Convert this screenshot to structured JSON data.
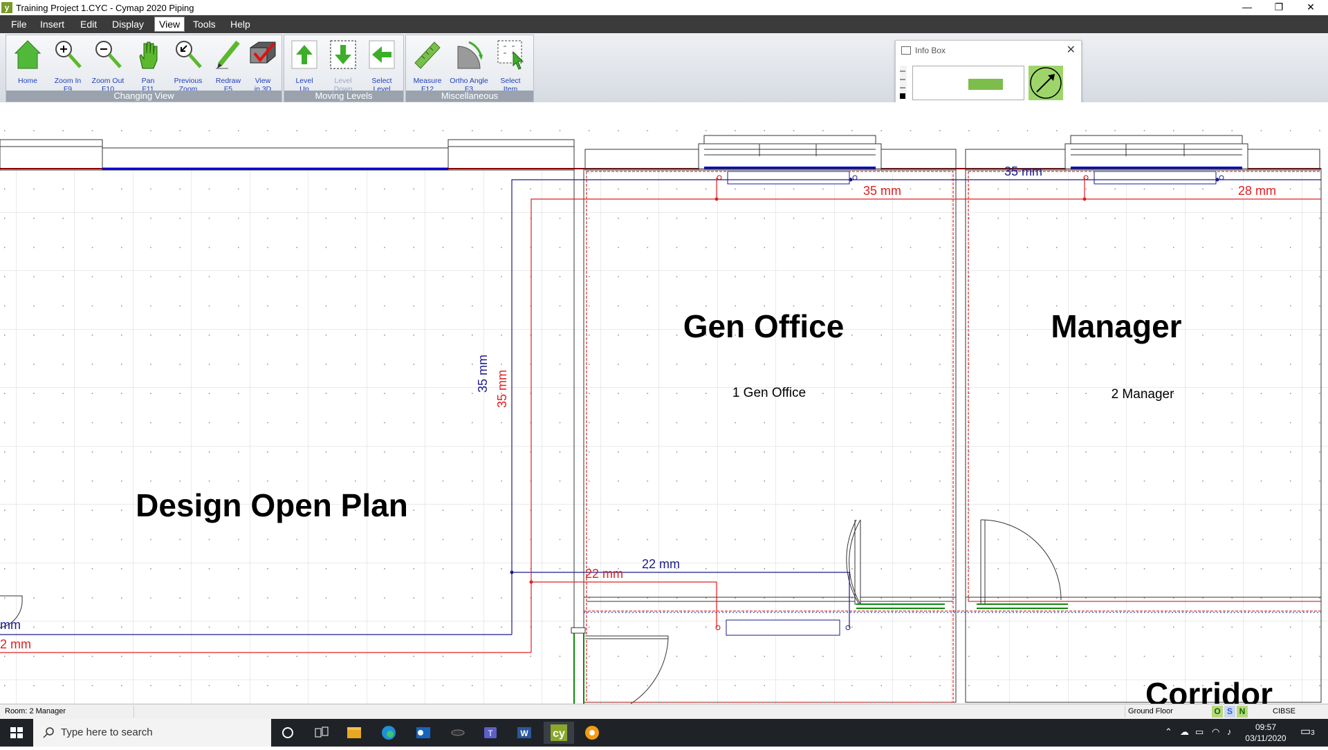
{
  "window": {
    "title": "Training Project 1.CYC - Cymap 2020 Piping",
    "app_icon": "cymap-app-icon",
    "controls": [
      "minimize-icon",
      "restore-icon",
      "close-icon"
    ]
  },
  "menu": {
    "items": [
      "File",
      "Insert",
      "Edit",
      "Display",
      "View",
      "Tools",
      "Help"
    ],
    "active": "View"
  },
  "ribbon": {
    "groups": [
      {
        "label": "Changing View",
        "buttons": [
          {
            "label": "Home",
            "shortcut": "",
            "icon": "home-icon"
          },
          {
            "label": "Zoom In",
            "shortcut": "F9",
            "icon": "zoom-in-icon"
          },
          {
            "label": "Zoom Out",
            "shortcut": "F10",
            "icon": "zoom-out-icon"
          },
          {
            "label": "Pan",
            "shortcut": "F11",
            "icon": "pan-hand-icon"
          },
          {
            "label": "Previous",
            "shortcut": "Zoom",
            "icon": "previous-zoom-icon"
          },
          {
            "label": "Redraw",
            "shortcut": "F5",
            "icon": "redraw-pencil-icon"
          },
          {
            "label": "View",
            "shortcut": "in 3D",
            "icon": "view-3d-icon"
          }
        ]
      },
      {
        "label": "Moving Levels",
        "buttons": [
          {
            "label": "Level",
            "shortcut": "Up",
            "icon": "level-up-icon"
          },
          {
            "label": "Level",
            "shortcut": "Down",
            "icon": "level-down-icon",
            "disabled": true
          },
          {
            "label": "Select",
            "shortcut": "Level",
            "icon": "select-level-icon"
          }
        ]
      },
      {
        "label": "Miscellaneous",
        "buttons": [
          {
            "label": "Measure",
            "shortcut": "F12",
            "icon": "measure-ruler-icon"
          },
          {
            "label": "Ortho Angle",
            "shortcut": "F3",
            "icon": "ortho-angle-icon"
          },
          {
            "label": "Select",
            "shortcut": "Item",
            "icon": "select-item-icon"
          }
        ]
      }
    ]
  },
  "info_box": {
    "title": "Info Box",
    "compass_icon": "north-compass-icon"
  },
  "drawing": {
    "rooms": [
      {
        "name": "Design Open Plan",
        "label": ""
      },
      {
        "name": "Gen Office",
        "label": "1 Gen Office"
      },
      {
        "name": "Manager",
        "label": "2 Manager"
      },
      {
        "name": "Corridor",
        "label": ""
      }
    ],
    "pipe_labels": {
      "flow_color": "#1a1a8c",
      "return_color": "#e02020",
      "flow_top_manager": "35 mm",
      "return_top_gen": "35 mm",
      "return_top_manager": "28 mm",
      "flow_vertical": "35 mm",
      "return_vertical": "35 mm",
      "flow_lower": "22 mm",
      "return_lower": "22 mm",
      "flow_left_partial": "mm",
      "return_left_partial": "2 mm"
    }
  },
  "status_bar": {
    "room": "Room: 2  Manager",
    "floor": "Ground Floor",
    "indicators": [
      "O",
      "S",
      "N"
    ],
    "standard": "CIBSE"
  },
  "taskbar": {
    "search_placeholder": "Type here to search",
    "apps": [
      "cortana-icon",
      "task-view-icon",
      "file-explorer-icon",
      "edge-icon",
      "outlook-icon",
      "app-icon",
      "teams-icon",
      "word-icon",
      "cymap-icon",
      "sun-app-icon"
    ],
    "time": "09:57",
    "date": "03/11/2020",
    "notifications": "3"
  }
}
